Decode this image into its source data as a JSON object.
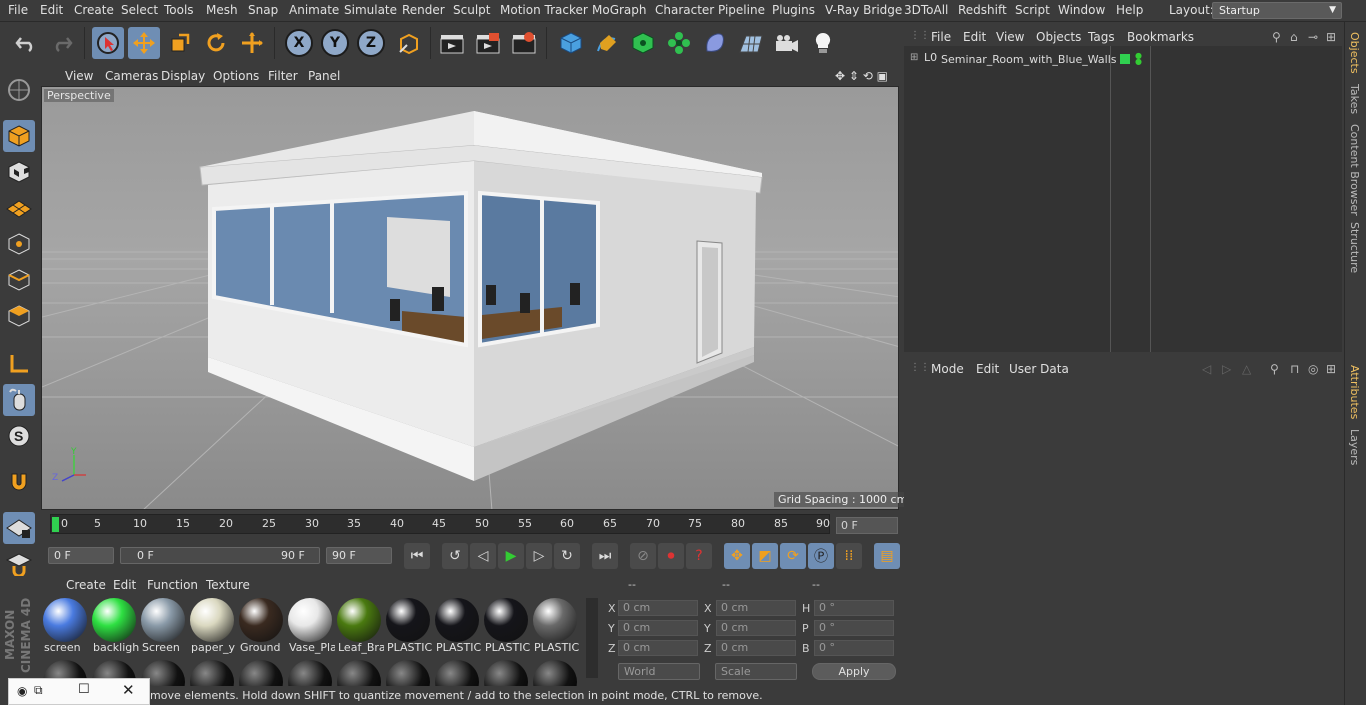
{
  "menubar": {
    "items": [
      "File",
      "Edit",
      "Create",
      "Select",
      "Tools",
      "Mesh",
      "Snap",
      "Animate",
      "Simulate",
      "Render",
      "Sculpt",
      "Motion Tracker",
      "MoGraph",
      "Character",
      "Pipeline",
      "Plugins",
      "V-Ray Bridge",
      "3DToAll",
      "Redshift",
      "Script",
      "Window",
      "Help"
    ],
    "layout_label": "Layout:",
    "layout_value": "Startup"
  },
  "toolbar": {
    "axis_x": "X",
    "axis_y": "Y",
    "axis_z": "Z"
  },
  "viewport": {
    "menu": [
      "View",
      "Cameras",
      "Display",
      "Options",
      "Filter",
      "Panel"
    ],
    "camera_label": "Perspective",
    "grid_spacing": "Grid Spacing : 1000 cm",
    "axis_y": "Y",
    "axis_z": "Z"
  },
  "timeline": {
    "ticks": [
      "0",
      "5",
      "10",
      "15",
      "20",
      "25",
      "30",
      "35",
      "40",
      "45",
      "50",
      "55",
      "60",
      "65",
      "70",
      "75",
      "80",
      "85",
      "90"
    ],
    "current_frame": "0 F"
  },
  "playback": {
    "start_frame": "0 F",
    "range_start": "0 F",
    "range_end": "90 F",
    "end_frame": "90 F"
  },
  "materials": {
    "menu": [
      "Create",
      "Edit",
      "Function",
      "Texture"
    ],
    "items": [
      {
        "label": "screen",
        "color": "#4a7be0"
      },
      {
        "label": "backligh",
        "color": "#2ee042"
      },
      {
        "label": "Screen",
        "color": "#8a9aa8"
      },
      {
        "label": "paper_y",
        "color": "#dad8c0"
      },
      {
        "label": "Ground",
        "color": "#3a2a20"
      },
      {
        "label": "Vase_Pla",
        "color": "#e8e8e8"
      },
      {
        "label": "Leaf_Bra",
        "color": "#4a7a10"
      },
      {
        "label": "PLASTIC",
        "color": "#15151a"
      },
      {
        "label": "PLASTIC",
        "color": "#15151a"
      },
      {
        "label": "PLASTIC",
        "color": "#15151a"
      },
      {
        "label": "PLASTIC",
        "color": "#6a6a6a"
      }
    ]
  },
  "coords": {
    "col_heads": [
      "--",
      "--",
      "--"
    ],
    "rows": [
      {
        "a": "X",
        "av": "0 cm",
        "b": "X",
        "bv": "0 cm",
        "c": "H",
        "cv": "0 °"
      },
      {
        "a": "Y",
        "av": "0 cm",
        "b": "Y",
        "bv": "0 cm",
        "c": "P",
        "cv": "0 °"
      },
      {
        "a": "Z",
        "av": "0 cm",
        "b": "Z",
        "bv": "0 cm",
        "c": "B",
        "cv": "0 °"
      }
    ],
    "world": "World",
    "scale": "Scale",
    "apply": "Apply"
  },
  "status": {
    "text": "move elements. Hold down SHIFT to quantize movement / add to the selection in point mode, CTRL to remove."
  },
  "objects": {
    "menu": [
      "File",
      "Edit",
      "View",
      "Objects",
      "Tags",
      "Bookmarks"
    ],
    "item": "Seminar_Room_with_Blue_Walls"
  },
  "attributes": {
    "menu": [
      "Mode",
      "Edit",
      "User Data"
    ]
  },
  "right_tabs": [
    "Objects",
    "Takes",
    "Content Browser",
    "Structure",
    "Attributes",
    "Layers"
  ],
  "brand": {
    "logo": "MAXON CINEMA 4D"
  }
}
